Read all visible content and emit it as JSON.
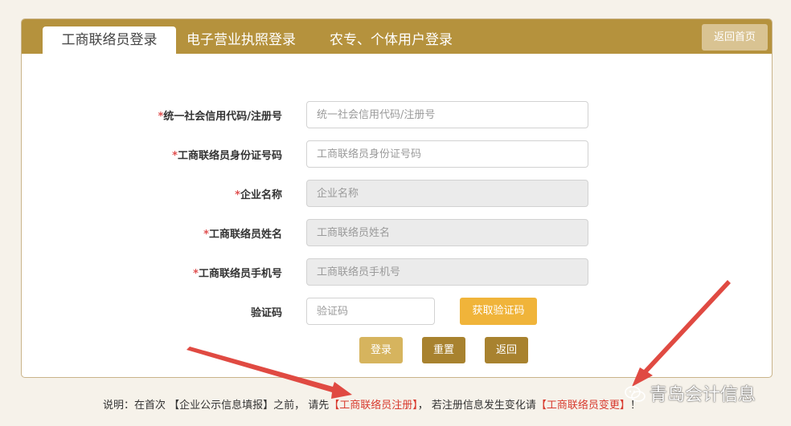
{
  "tabs": [
    {
      "label": "工商联络员登录",
      "active": true
    },
    {
      "label": "电子营业执照登录",
      "active": false
    },
    {
      "label": "农专、个体用户登录",
      "active": false
    }
  ],
  "header": {
    "home_button": "返回首页"
  },
  "form": {
    "required_mark": "*",
    "fields": [
      {
        "label": "统一社会信用代码/注册号",
        "placeholder": "统一社会信用代码/注册号",
        "readonly": false
      },
      {
        "label": "工商联络员身份证号码",
        "placeholder": "工商联络员身份证号码",
        "readonly": false
      },
      {
        "label": "企业名称",
        "placeholder": "企业名称",
        "readonly": true
      },
      {
        "label": "工商联络员姓名",
        "placeholder": "工商联络员姓名",
        "readonly": true
      },
      {
        "label": "工商联络员手机号",
        "placeholder": "工商联络员手机号",
        "readonly": true
      }
    ],
    "captcha": {
      "label": "验证码",
      "placeholder": "验证码",
      "button": "获取验证码"
    },
    "actions": {
      "login": "登录",
      "reset": "重置",
      "back": "返回"
    }
  },
  "note": {
    "prefix": "说明：在首次 【企业公示信息填报】之前， 请先",
    "link1": "【工商联络员注册】",
    "middle": "， 若注册信息发生变化请",
    "link2": "【工商联络员变更】",
    "suffix": "！"
  },
  "watermark": {
    "text": "青岛会计信息",
    "icon": "wechat-icon"
  },
  "colors": {
    "header": "#b5923d",
    "home_button": "#d9c392",
    "sms_button": "#f0b43a",
    "login_button": "#d6b45e",
    "reset_button": "#a8822f",
    "back_button": "#a8822f",
    "link": "#d83a2e",
    "arrow": "#e04a42"
  }
}
